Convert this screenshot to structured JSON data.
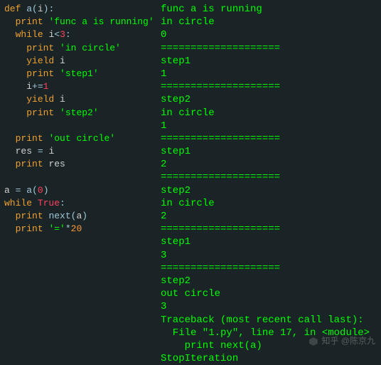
{
  "code": {
    "l1_kw1": "def",
    "l1_fn": "a",
    "l1_op1": "(",
    "l1_var": "i",
    "l1_op2": "):",
    "l2_kw": "print",
    "l2_str": "'func a is running'",
    "l3_kw": "while",
    "l3_var": "i",
    "l3_op": "<",
    "l3_num": "3",
    "l3_colon": ":",
    "l4_kw": "print",
    "l4_str": "'in circle'",
    "l5_kw": "yield",
    "l5_var": "i",
    "l6_kw": "print",
    "l6_str": "'step1'",
    "l7_var": "i",
    "l7_op": "+=",
    "l7_num": "1",
    "l8_kw": "yield",
    "l8_var": "i",
    "l9_kw": "print",
    "l9_str": "'step2'",
    "l10_kw": "print",
    "l10_str": "'out circle'",
    "l11_var1": "res",
    "l11_op": "=",
    "l11_var2": "i",
    "l12_kw": "print",
    "l12_var": "res",
    "l13_var1": "a",
    "l13_op": "=",
    "l13_fn": "a",
    "l13_paren": "(",
    "l13_num": "0",
    "l13_paren2": ")",
    "l14_kw": "while",
    "l14_bool": "True",
    "l14_colon": ":",
    "l15_kw": "print",
    "l15_fn": "next",
    "l15_op1": "(",
    "l15_var": "a",
    "l15_op2": ")",
    "l16_kw": "print",
    "l16_str": "'='",
    "l16_op": "*",
    "l16_num": "20"
  },
  "output": {
    "lines": [
      "func a is running",
      "in circle",
      "0",
      "====================",
      "step1",
      "1",
      "====================",
      "step2",
      "in circle",
      "1",
      "====================",
      "step1",
      "2",
      "====================",
      "step2",
      "in circle",
      "2",
      "====================",
      "step1",
      "3",
      "====================",
      "step2",
      "out circle",
      "3",
      "Traceback (most recent call last):",
      "  File \"1.py\", line 17, in <module>",
      "    print next(a)",
      "StopIteration"
    ]
  },
  "watermark": {
    "text": "知乎 @陈京九"
  },
  "chart_data": null
}
